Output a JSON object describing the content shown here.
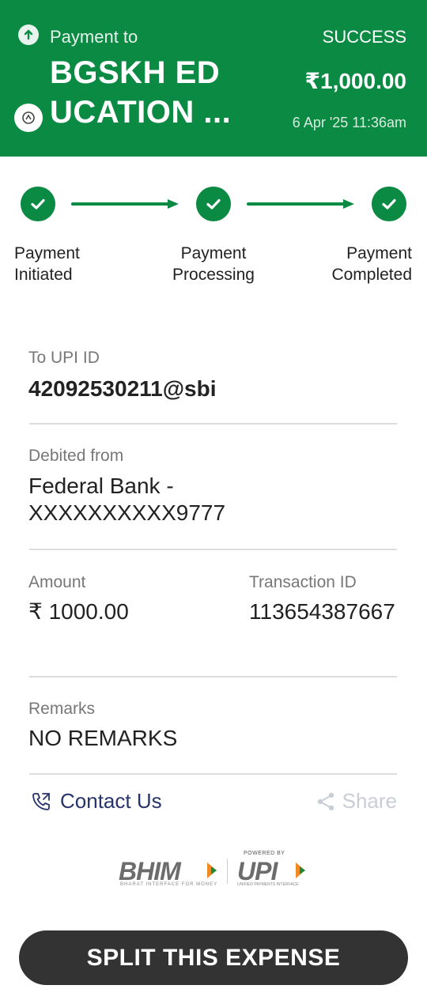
{
  "header": {
    "payment_to_label": "Payment to",
    "payee_line1": "BGSKH ED",
    "payee_line2": "UCATION ...",
    "status": "SUCCESS",
    "amount": "₹1,000.00",
    "datetime": "6 Apr '25 11:36am",
    "bg_color": "#0a8a43",
    "icons": {
      "left": "arrow-up-icon",
      "bank": "bank-logo-icon"
    }
  },
  "steps": [
    {
      "line1": "Payment",
      "line2": "Initiated"
    },
    {
      "line1": "Payment",
      "line2": "Processing"
    },
    {
      "line1": "Payment",
      "line2": "Completed"
    }
  ],
  "details": {
    "upi_label": "To UPI ID",
    "upi_value": "42092530211@sbi",
    "debited_label": "Debited from",
    "debited_value": "Federal Bank - XXXXXXXXXX9777",
    "amount_label": "Amount",
    "amount_value": "₹ 1000.00",
    "txn_label": "Transaction ID",
    "txn_value": "113654387667",
    "remarks_label": "Remarks",
    "remarks_value": "NO REMARKS"
  },
  "actions": {
    "contact_label": "Contact Us",
    "share_label": "Share",
    "contact_color": "#27346b",
    "share_color": "#c8cdd6"
  },
  "logos": {
    "bhim": "BHIM",
    "bhim_tagline": "BHARAT INTERFACE FOR MONEY",
    "powered_by": "POWERED BY",
    "upi": "UPI",
    "upi_tagline": "UNIFIED PAYMENTS INTERFACE"
  },
  "cta": {
    "label": "SPLIT THIS EXPENSE"
  }
}
